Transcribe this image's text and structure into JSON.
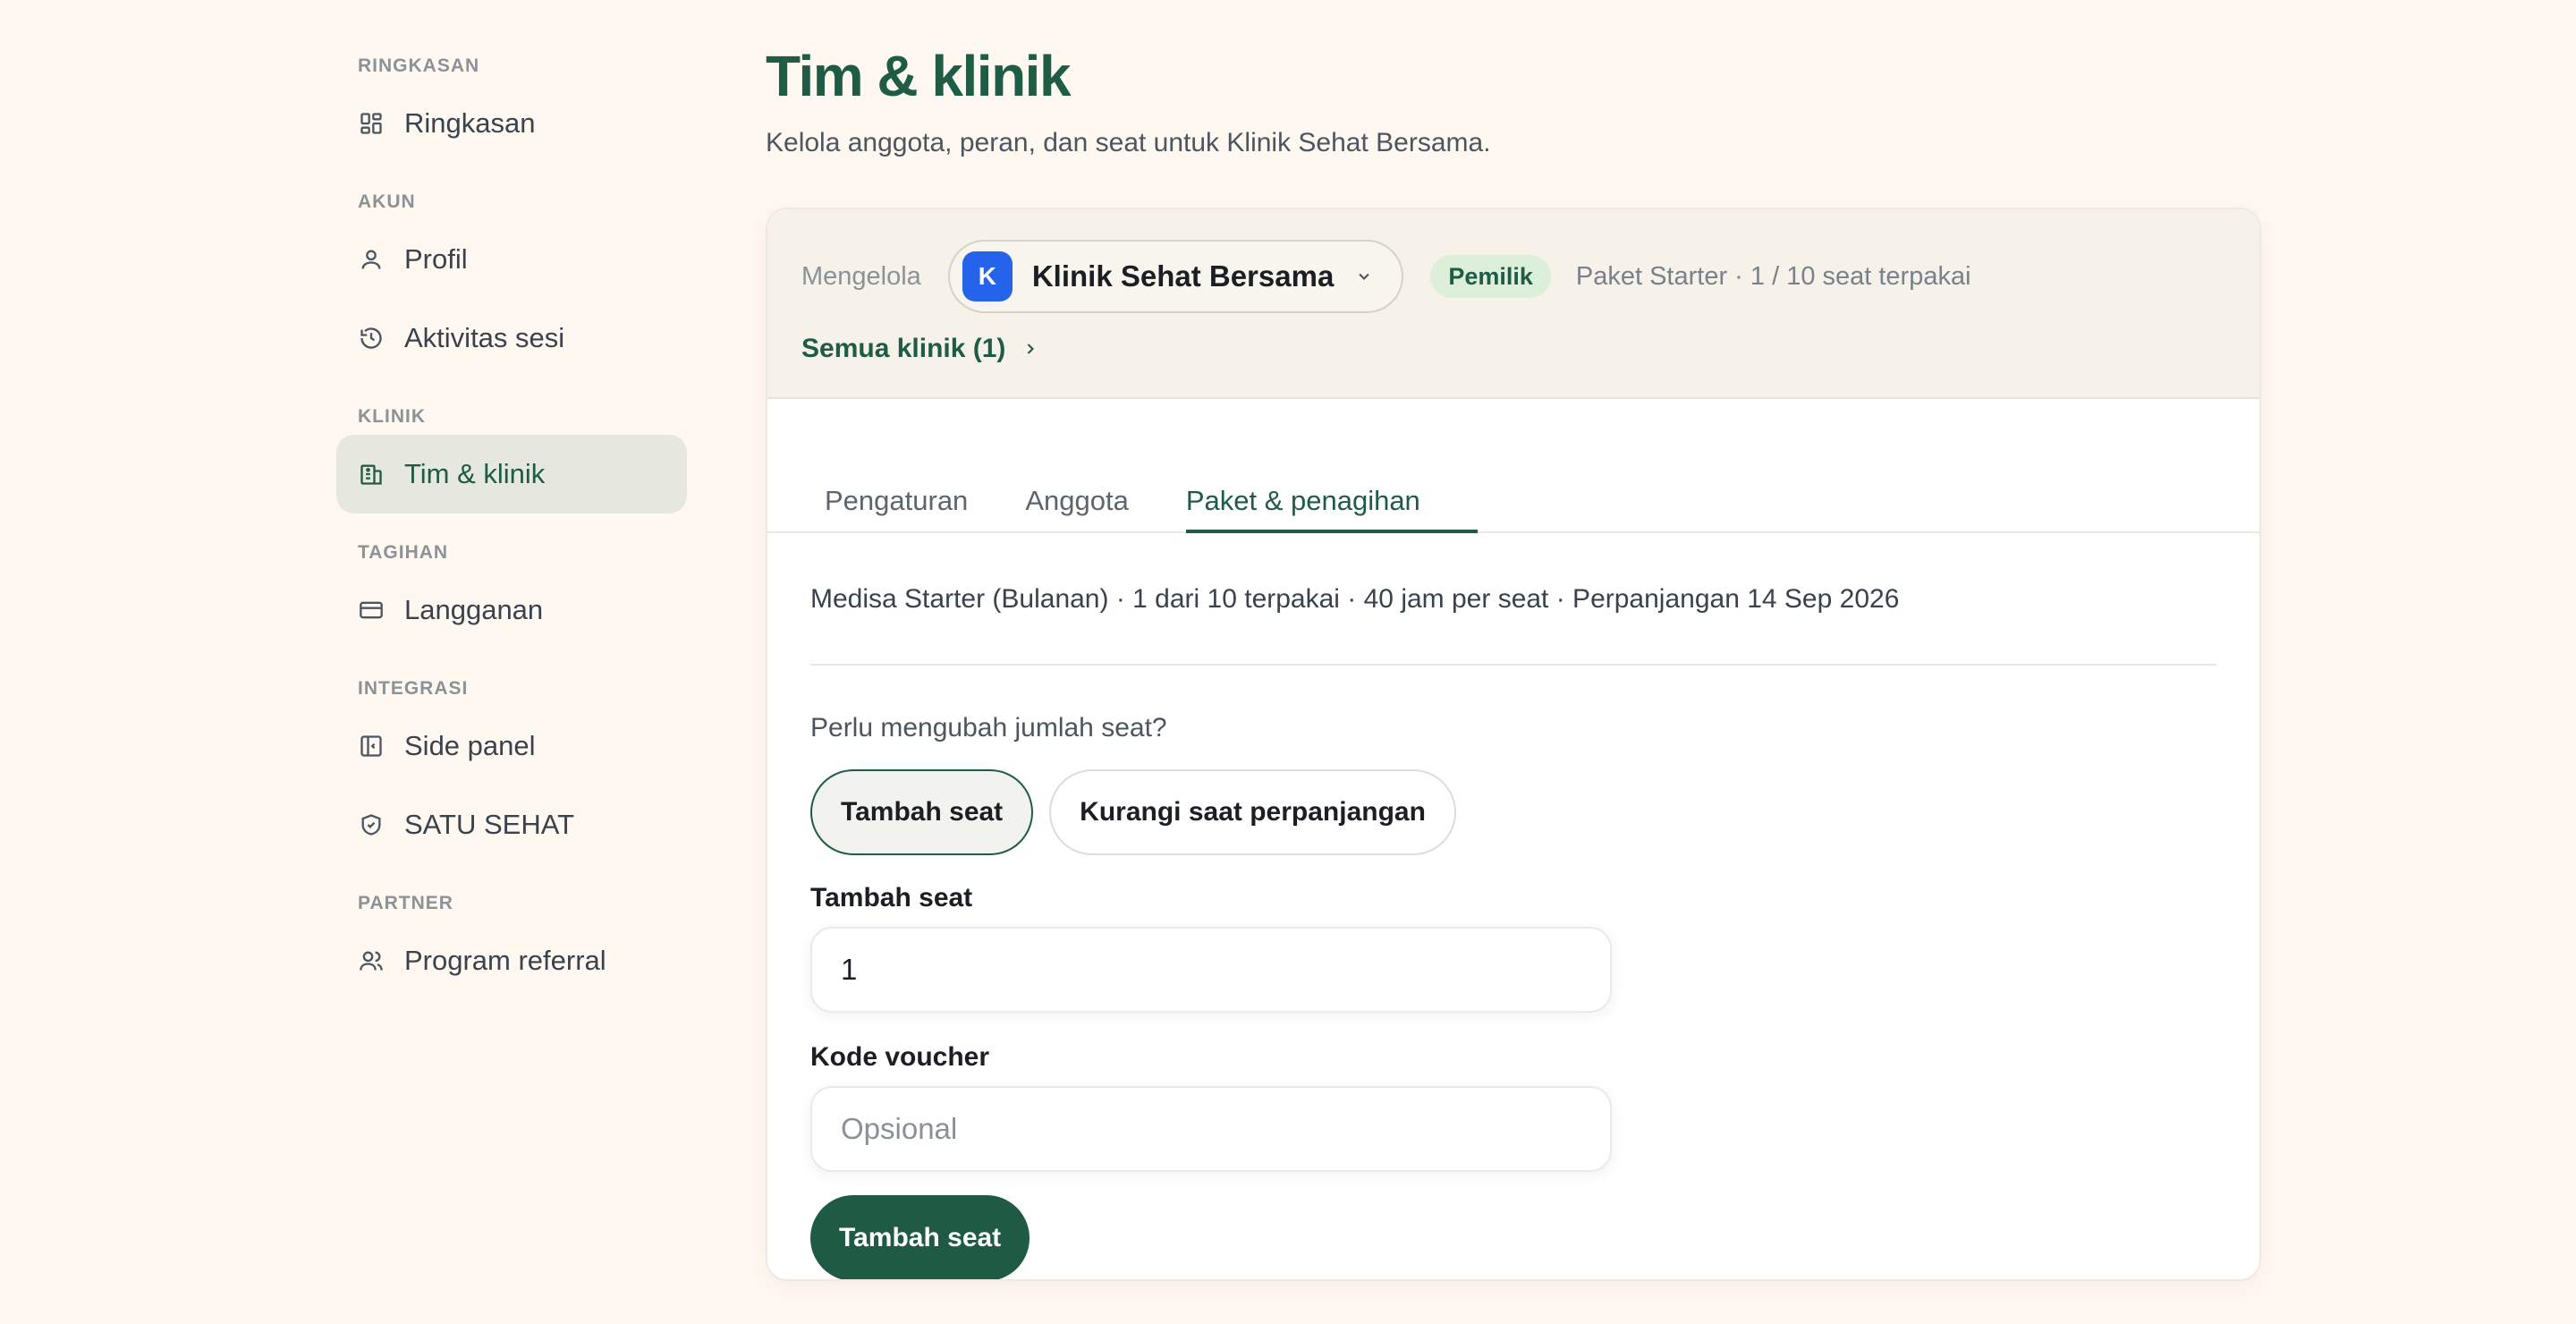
{
  "sidebar": {
    "sections": [
      {
        "label": "RINGKASAN",
        "items": [
          {
            "label": "Ringkasan",
            "icon": "dashboard-icon"
          }
        ]
      },
      {
        "label": "AKUN",
        "items": [
          {
            "label": "Profil",
            "icon": "user-icon"
          },
          {
            "label": "Aktivitas sesi",
            "icon": "history-icon"
          }
        ]
      },
      {
        "label": "KLINIK",
        "items": [
          {
            "label": "Tim & klinik",
            "icon": "building-icon",
            "active": true
          }
        ]
      },
      {
        "label": "TAGIHAN",
        "items": [
          {
            "label": "Langganan",
            "icon": "credit-card-icon"
          }
        ]
      },
      {
        "label": "INTEGRASI",
        "items": [
          {
            "label": "Side panel",
            "icon": "side-panel-icon"
          },
          {
            "label": "SATU SEHAT",
            "icon": "shield-check-icon"
          }
        ]
      },
      {
        "label": "PARTNER",
        "items": [
          {
            "label": "Program referral",
            "icon": "users-icon"
          }
        ]
      }
    ]
  },
  "header": {
    "title": "Tim & klinik",
    "subtitle": "Kelola anggota, peran, dan seat untuk Klinik Sehat Bersama."
  },
  "clinic_bar": {
    "managing_label": "Mengelola",
    "avatar_letter": "K",
    "avatar_color": "#2563eb",
    "clinic_name": "Klinik Sehat Bersama",
    "role_badge": "Pemilik",
    "plan_summary": "Paket Starter · 1 / 10 seat terpakai",
    "all_clinics_link": "Semua klinik (1)"
  },
  "tabs": [
    {
      "label": "Pengaturan",
      "active": false
    },
    {
      "label": "Anggota",
      "active": false
    },
    {
      "label": "Paket & penagihan",
      "active": true
    }
  ],
  "billing": {
    "plan_line": "Medisa Starter (Bulanan) · 1 dari 10 terpakai · 40 jam per seat · Perpanjangan 14 Sep 2026",
    "question": "Perlu mengubah jumlah seat?",
    "segment_options": [
      {
        "label": "Tambah seat",
        "active": true
      },
      {
        "label": "Kurangi saat perpanjangan",
        "active": false
      }
    ],
    "seat_field": {
      "label": "Tambah seat",
      "value": "1"
    },
    "voucher_field": {
      "label": "Kode voucher",
      "placeholder": "Opsional"
    },
    "submit_label": "Tambah seat"
  },
  "colors": {
    "accent": "#1f5c45",
    "background": "#fff8f1",
    "badge_bg": "#dcefd9"
  }
}
